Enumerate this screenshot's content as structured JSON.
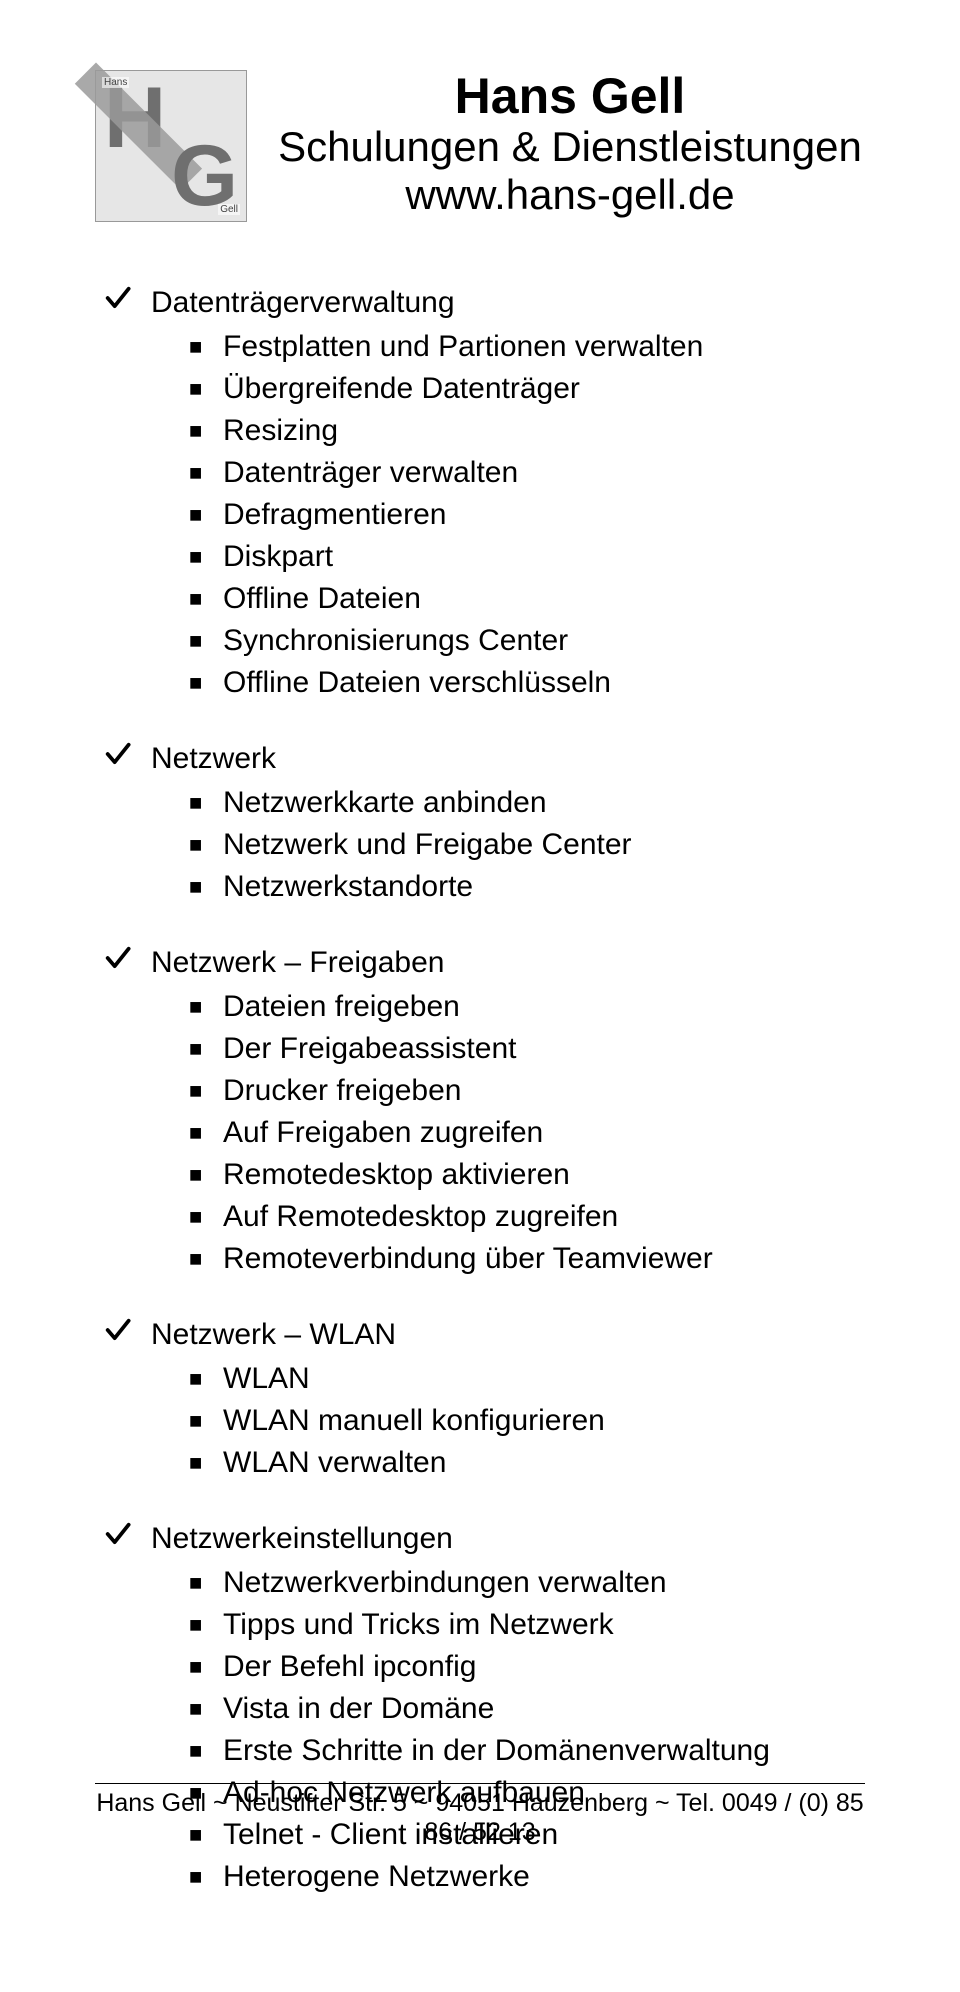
{
  "header": {
    "title": "Hans Gell",
    "subtitle": "Schulungen & Dienstleistungen",
    "url": "www.hans-gell.de",
    "logo_hans": "Hans",
    "logo_gell": "Gell"
  },
  "sections": [
    {
      "title": "Datenträgerverwaltung",
      "items": [
        "Festplatten und Partionen verwalten",
        "Übergreifende Datenträger",
        "Resizing",
        "Datenträger verwalten",
        "Defragmentieren",
        "Diskpart",
        "Offline Dateien",
        "Synchronisierungs Center",
        "Offline Dateien verschlüsseln"
      ]
    },
    {
      "title": "Netzwerk",
      "items": [
        "Netzwerkkarte anbinden",
        "Netzwerk und Freigabe Center",
        "Netzwerkstandorte"
      ]
    },
    {
      "title": "Netzwerk – Freigaben",
      "items": [
        "Dateien freigeben",
        "Der Freigabeassistent",
        "Drucker freigeben",
        "Auf Freigaben zugreifen",
        "Remotedesktop aktivieren",
        "Auf Remotedesktop zugreifen",
        "Remoteverbindung über Teamviewer"
      ]
    },
    {
      "title": "Netzwerk – WLAN",
      "items": [
        "WLAN",
        "WLAN manuell konfigurieren",
        "WLAN verwalten"
      ]
    },
    {
      "title": "Netzwerkeinstellungen",
      "items": [
        "Netzwerkverbindungen verwalten",
        "Tipps und Tricks im Netzwerk",
        "Der Befehl ipconfig",
        "Vista in der Domäne",
        "Erste Schritte in der Domänenverwaltung",
        "Ad-hoc Netzwerk aufbauen",
        "Telnet - Client installieren",
        "Heterogene Netzwerke"
      ]
    }
  ],
  "footer": "Hans Gell ~ Neustifter Str. 5 ~ 94051 Hauzenberg ~ Tel. 0049 / (0) 85 86 / 52 13"
}
